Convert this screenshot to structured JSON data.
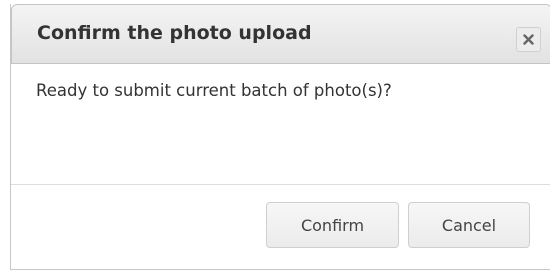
{
  "dialog": {
    "title": "Confirm the photo upload",
    "close_icon": "close-icon",
    "message": "Ready to submit current batch of photo(s)?",
    "buttons": {
      "confirm_label": "Confirm",
      "cancel_label": "Cancel"
    }
  }
}
